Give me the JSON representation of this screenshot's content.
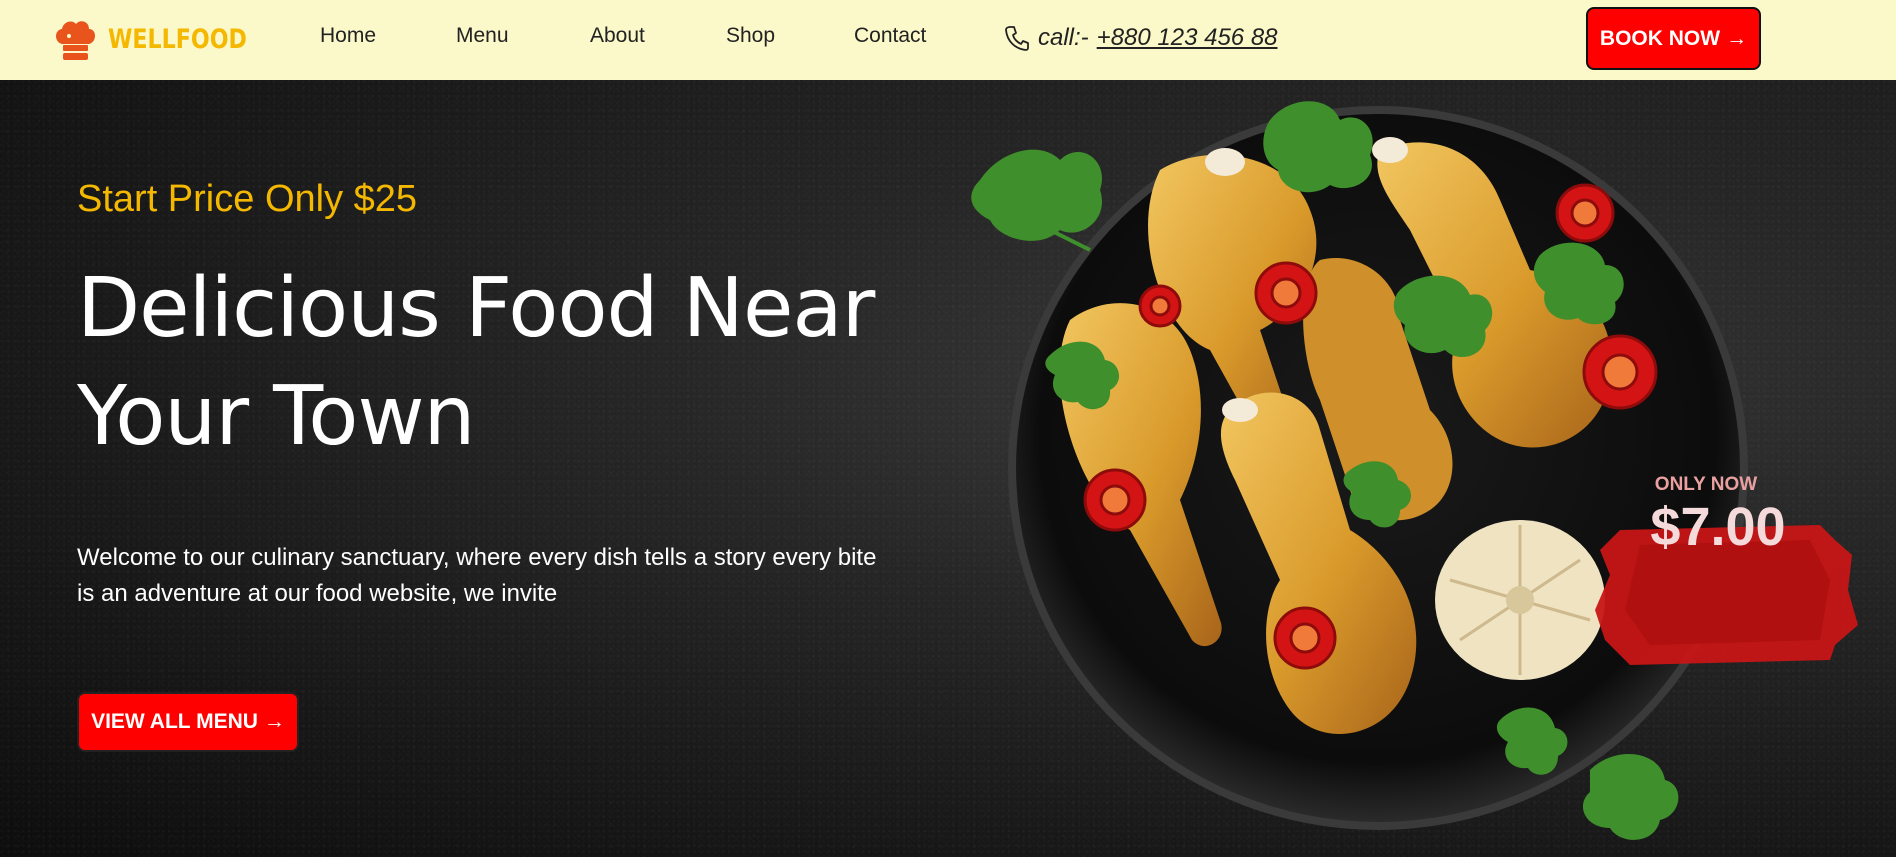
{
  "brand": {
    "name": "WELLFOOD",
    "icon": "chef-hat-icon",
    "color": "#f5b800"
  },
  "nav": {
    "items": [
      {
        "label": "Home"
      },
      {
        "label": "Menu"
      },
      {
        "label": "About"
      },
      {
        "label": "Shop"
      },
      {
        "label": "Contact"
      }
    ]
  },
  "contact": {
    "icon": "phone-icon",
    "prefix": "call:-",
    "number": " +880 123 456 88"
  },
  "header_cta": {
    "label": "BOOK NOW",
    "arrow": "→"
  },
  "hero": {
    "tagline": "Start Price Only $25",
    "headline": "Delicious Food Near Your Town",
    "intro": "Welcome to our culinary sanctuary, where every dish tells a story every bite is an adventure at our food website, we invite",
    "cta_label": "VIEW ALL MENU",
    "cta_arrow": "→"
  },
  "promo": {
    "label": "ONLY NOW",
    "price": "$7.00"
  },
  "colors": {
    "nav_bg": "#fbf8c9",
    "accent": "#ff0000",
    "highlight": "#f5b800",
    "hero_bg": "#1c1c1c"
  }
}
